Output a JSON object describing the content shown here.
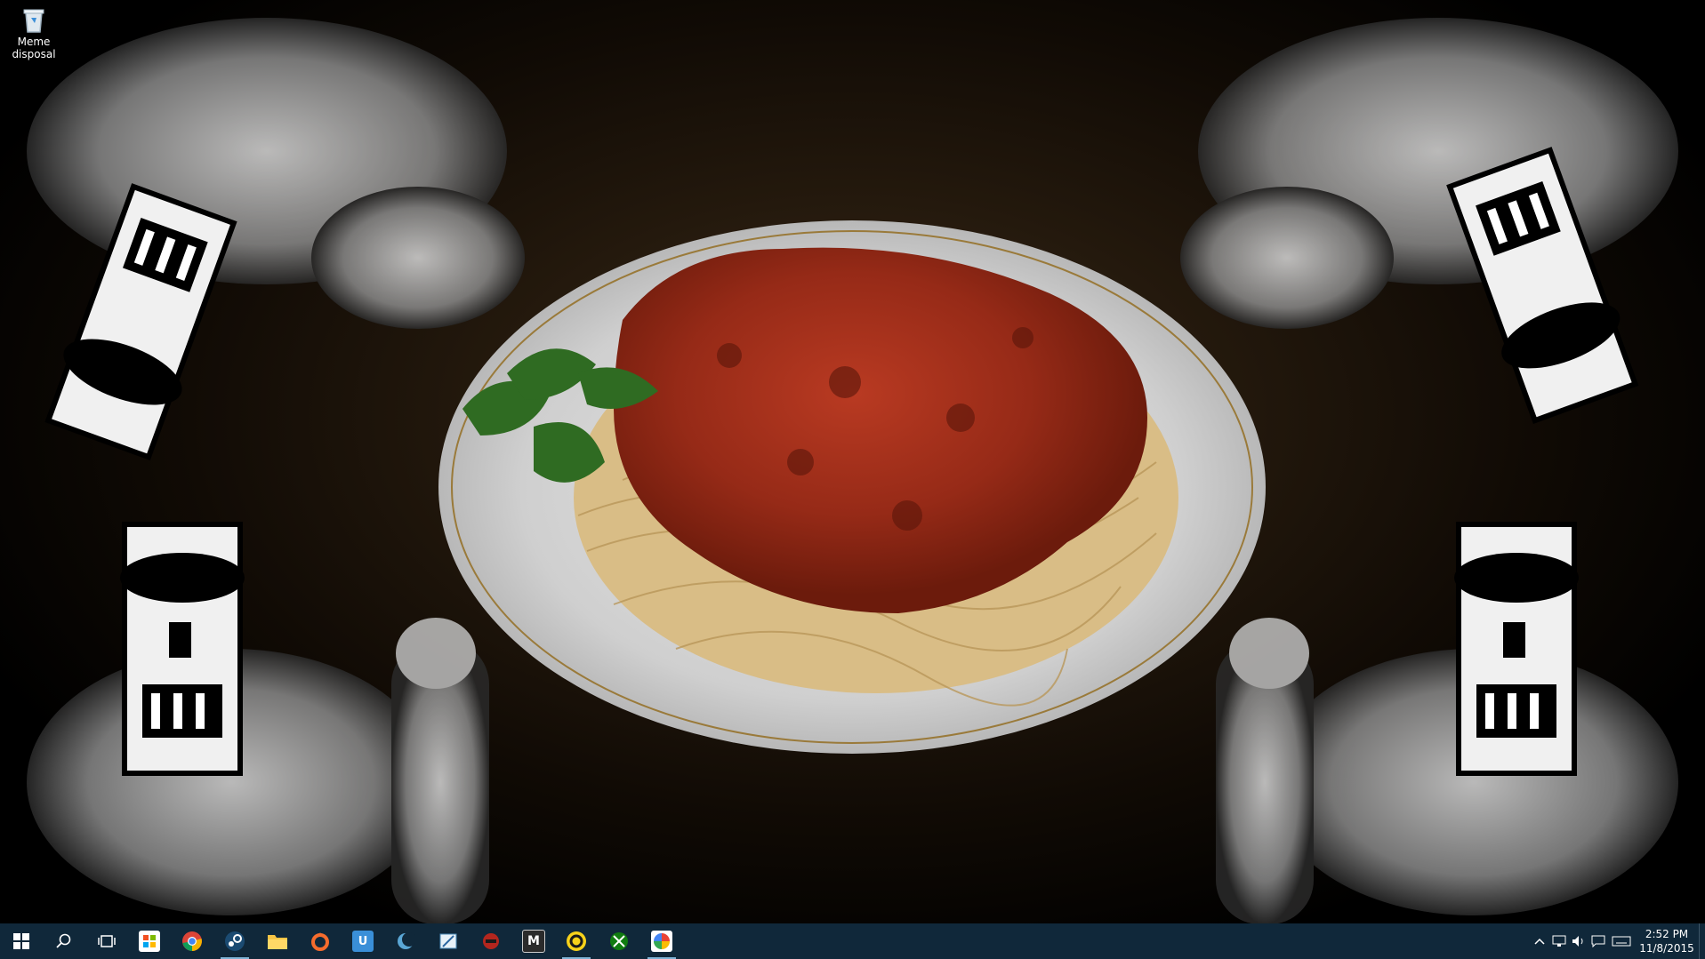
{
  "desktop": {
    "icons": [
      {
        "label": "Meme\ndisposal",
        "icon": "recycle-bin-icon"
      }
    ]
  },
  "taskbar": {
    "start_icon": "windows-start-icon",
    "search_icon": "search-icon",
    "task_view_icon": "task-view-icon",
    "pinned": [
      {
        "name": "store-icon",
        "running": false
      },
      {
        "name": "chrome-icon",
        "running": false
      },
      {
        "name": "steam-icon",
        "running": true
      },
      {
        "name": "file-explorer-icon",
        "running": false
      },
      {
        "name": "origin-icon",
        "running": false
      },
      {
        "name": "uplay-icon",
        "running": false
      },
      {
        "name": "moon-app-icon",
        "running": false
      },
      {
        "name": "editor-icon",
        "running": false
      },
      {
        "name": "red-game-icon",
        "running": false
      },
      {
        "name": "m-app-icon",
        "running": false
      },
      {
        "name": "yellow-app-icon",
        "running": true
      },
      {
        "name": "xbox-icon",
        "running": false
      },
      {
        "name": "picasa-icon",
        "running": true
      }
    ],
    "tray": {
      "icons": [
        "chevron-up-icon",
        "network-icon",
        "volume-icon",
        "action-center-icon",
        "keyboard-icon"
      ],
      "time": "2:52 PM",
      "date": "11/8/2015"
    }
  },
  "colors": {
    "taskbar": "#10283a",
    "accent": "#7fb3d6"
  }
}
